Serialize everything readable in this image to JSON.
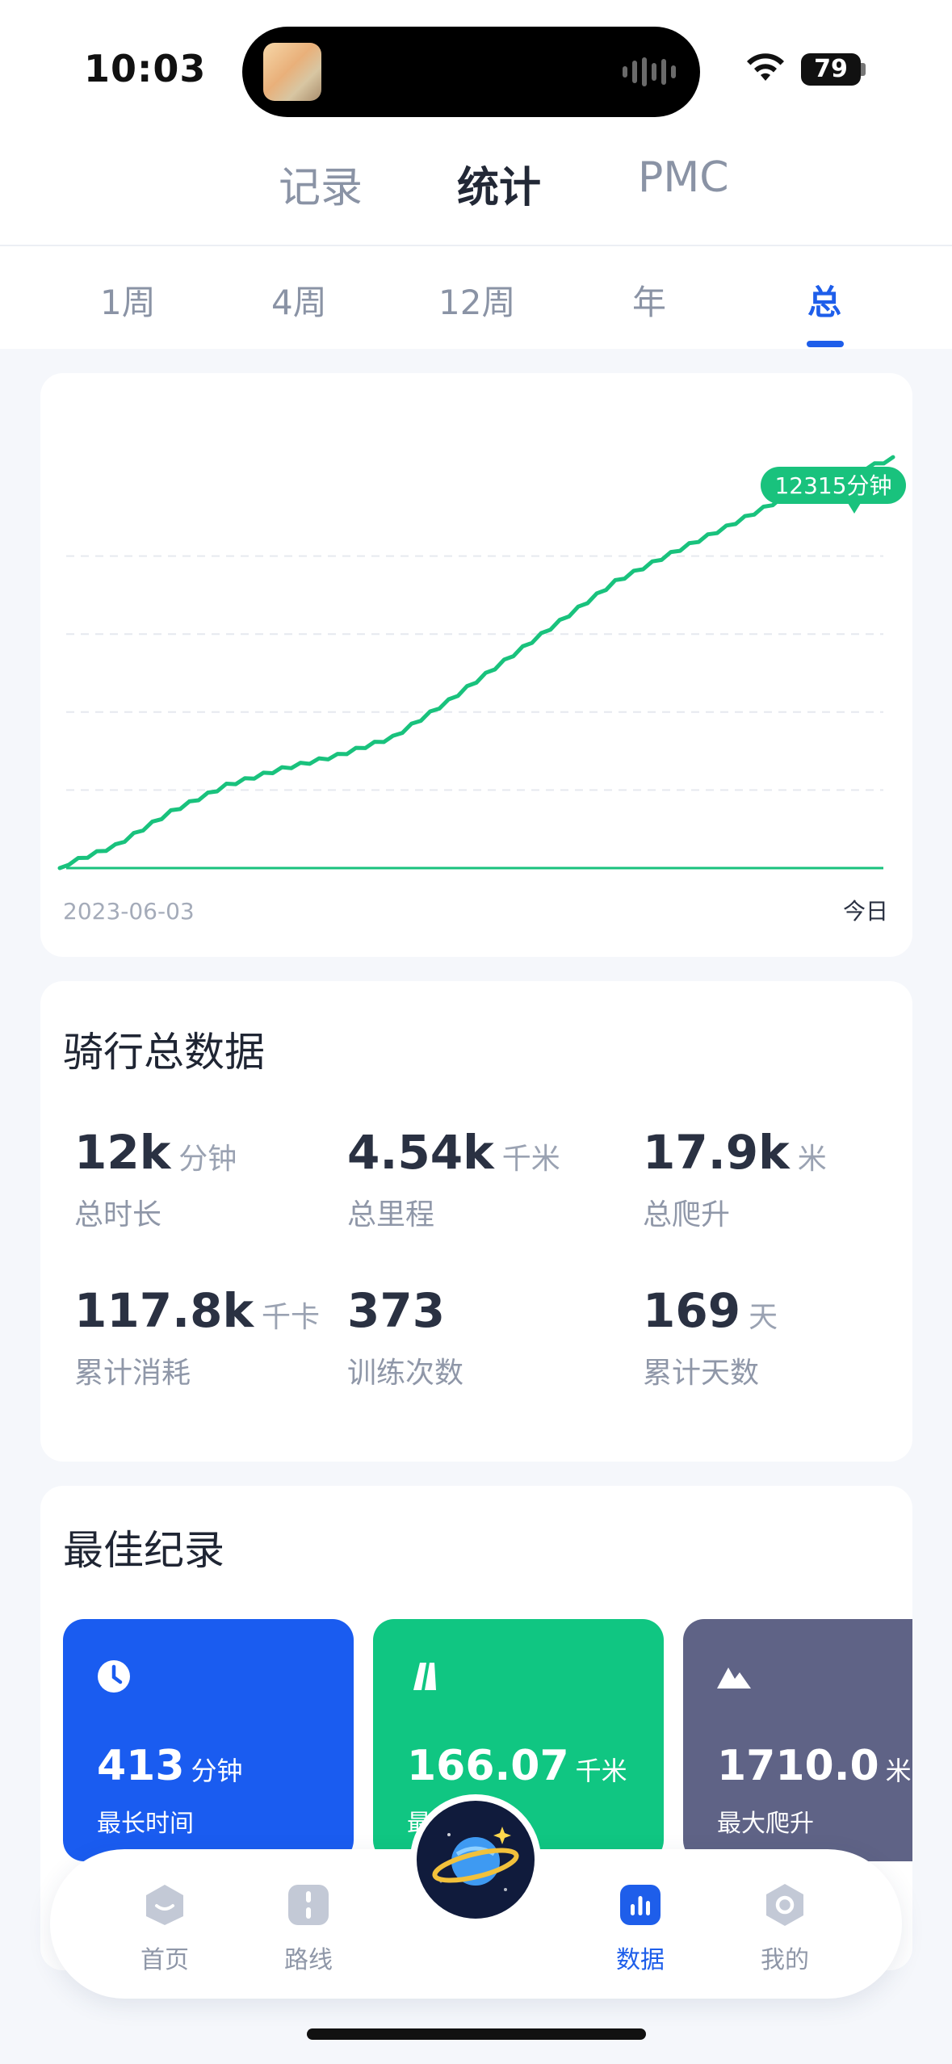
{
  "status_bar": {
    "time": "10:03",
    "battery": "79"
  },
  "top_tabs": [
    {
      "label": "记录",
      "active": false
    },
    {
      "label": "统计",
      "active": true
    },
    {
      "label": "PMC",
      "active": false
    }
  ],
  "period_tabs": [
    {
      "label": "1周",
      "active": false
    },
    {
      "label": "4周",
      "active": false
    },
    {
      "label": "12周",
      "active": false
    },
    {
      "label": "年",
      "active": false
    },
    {
      "label": "总",
      "active": true
    }
  ],
  "chart": {
    "start_label": "2023-06-03",
    "end_label": "今日",
    "tooltip": "12315分钟",
    "line_color": "#19c27d"
  },
  "chart_data": {
    "type": "line",
    "x_labels": [
      "2023-06-03",
      "今日"
    ],
    "series": [
      {
        "values": [
          0,
          620,
          1650,
          2450,
          2950,
          3350,
          3900,
          5000,
          6200,
          7400,
          8600,
          9450,
          10250,
          11100,
          11750,
          12315
        ]
      }
    ],
    "annotation": "12315分钟",
    "ylim": [
      0,
      13000
    ],
    "grid": "horizontal-dashed"
  },
  "summary": {
    "title": "骑行总数据",
    "stats": [
      {
        "value": "12k",
        "unit": "分钟",
        "label": "总时长"
      },
      {
        "value": "4.54k",
        "unit": "千米",
        "label": "总里程"
      },
      {
        "value": "17.9k",
        "unit": "米",
        "label": "总爬升"
      },
      {
        "value": "117.8k",
        "unit": "千卡",
        "label": "累计消耗"
      },
      {
        "value": "373",
        "unit": "",
        "label": "训练次数"
      },
      {
        "value": "169",
        "unit": "天",
        "label": "累计天数"
      }
    ]
  },
  "best": {
    "title": "最佳纪录",
    "tiles": [
      {
        "value": "413",
        "unit": "分钟",
        "label": "最长时间",
        "color": "#1a5cf0",
        "icon": "clock-icon"
      },
      {
        "value": "166.07",
        "unit": "千米",
        "label": "最大里程",
        "color": "#10c682",
        "icon": "road-icon"
      },
      {
        "value": "1710.0",
        "unit": "米",
        "label": "最大爬升",
        "color": "#5f6386",
        "icon": "mountain-icon"
      }
    ]
  },
  "tab_bar": [
    {
      "label": "首页",
      "icon": "home-icon",
      "active": false
    },
    {
      "label": "路线",
      "icon": "route-icon",
      "active": false
    },
    {
      "label": "数据",
      "icon": "chart-icon",
      "active": true
    },
    {
      "label": "我的",
      "icon": "profile-icon",
      "active": false
    }
  ],
  "colors": {
    "accent": "#1e5eea",
    "green": "#19c27d"
  }
}
